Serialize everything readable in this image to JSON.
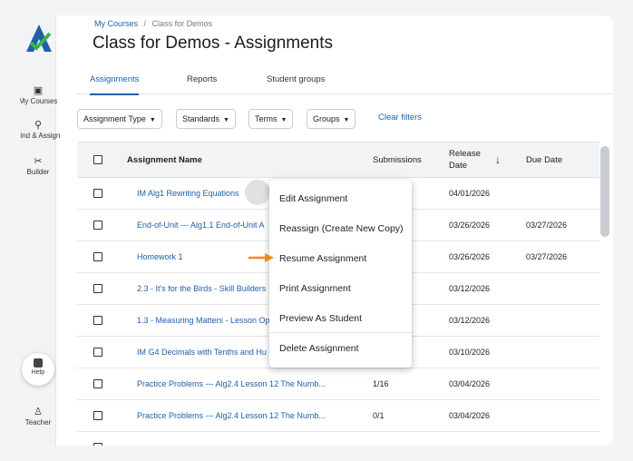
{
  "breadcrumb": {
    "root": "My Courses",
    "sep": "/",
    "current": "Class for Demos"
  },
  "page_title": "Class for Demos - Assignments",
  "tabs": [
    {
      "label": "Assignments",
      "active": true
    },
    {
      "label": "Reports",
      "active": false
    },
    {
      "label": "Student groups",
      "active": false
    }
  ],
  "rail": {
    "items": [
      {
        "icon": "courses-icon",
        "label": "My Courses"
      },
      {
        "icon": "search-icon",
        "label": "Find & Assign"
      },
      {
        "icon": "builder-icon",
        "label": "Builder"
      }
    ],
    "help": "Help",
    "teacher": "Teacher"
  },
  "filters": {
    "buttons": [
      "Assignment Type",
      "Standards",
      "Terms",
      "Groups"
    ],
    "clear": "Clear filters"
  },
  "table": {
    "headers": {
      "name": "Assignment Name",
      "submissions": "Submissions",
      "release": "Release Date",
      "due": "Due Date"
    },
    "rows": [
      {
        "name": "IM Alg1 Rewriting Equations",
        "submissions": "",
        "release": "04/01/2026",
        "due": ""
      },
      {
        "name": "End-of-Unit --- Alg1.1 End-of-Unit A",
        "submissions": "",
        "release": "03/26/2026",
        "due": "03/27/2026"
      },
      {
        "name": "Homework 1",
        "submissions": "",
        "release": "03/26/2026",
        "due": "03/27/2026"
      },
      {
        "name": "2.3 - It's for the Birds - Skill Builders",
        "submissions": "",
        "release": "03/12/2026",
        "due": ""
      },
      {
        "name": "1.3 - Measuring Matters - Lesson Op",
        "submissions": "",
        "release": "03/12/2026",
        "due": ""
      },
      {
        "name": "IM G4 Decimals with Tenths and Hu",
        "submissions": "",
        "release": "03/10/2026",
        "due": ""
      },
      {
        "name": "Practice Problems --- Alg2.4 Lesson 12 The Numb...",
        "submissions": "1/16",
        "release": "03/04/2026",
        "due": ""
      },
      {
        "name": "Practice Problems --- Alg2.4 Lesson 12 The Numb...",
        "submissions": "0/1",
        "release": "03/04/2026",
        "due": ""
      }
    ]
  },
  "context_menu": {
    "items": [
      "Edit Assignment",
      "Reassign (Create New Copy)",
      "Resume Assignment",
      "Print Assignment",
      "Preview As Student",
      "Delete Assignment"
    ]
  },
  "colors": {
    "accent": "#1f5fa8",
    "arrow": "#f08a1c"
  }
}
